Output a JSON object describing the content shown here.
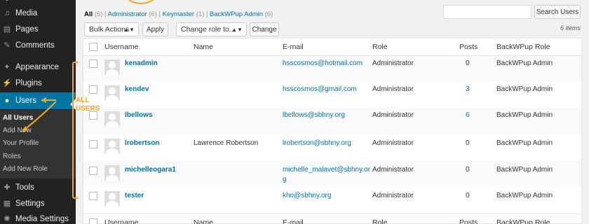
{
  "sidebar": {
    "items": [
      {
        "label": "Media",
        "icon": "media-icon",
        "glyph": "♫"
      },
      {
        "label": "Pages",
        "icon": "pages-icon",
        "glyph": "▤"
      },
      {
        "label": "Comments",
        "icon": "comments-icon",
        "glyph": "✎"
      },
      {
        "label": "Appearance",
        "icon": "appearance-icon",
        "glyph": "✦"
      },
      {
        "label": "Plugins",
        "icon": "plugins-icon",
        "glyph": "⚡"
      },
      {
        "label": "Users",
        "icon": "users-icon",
        "glyph": "●"
      },
      {
        "label": "Tools",
        "icon": "tools-icon",
        "glyph": "✚"
      },
      {
        "label": "Settings",
        "icon": "settings-icon",
        "glyph": "▦"
      },
      {
        "label": "Media Settings",
        "icon": "gear-icon",
        "glyph": "✺"
      }
    ],
    "submenu": [
      "All Users",
      "Add New",
      "Your Profile",
      "Roles",
      "Add New Role"
    ]
  },
  "annotation": {
    "label_line1": "ALL",
    "label_line2": "USERS",
    "color": "#f5a623"
  },
  "filters": {
    "all": "All",
    "all_count": "(6)",
    "administrator": "Administrator",
    "administrator_count": "(6)",
    "keymaster": "Keymaster",
    "keymaster_count": "(1)",
    "backwpup_admin": "BackWPup Admin",
    "backwpup_admin_count": "(6)",
    "sep": "|"
  },
  "search": {
    "button_label": "Search Users",
    "placeholder": ""
  },
  "bulk": {
    "actions_label": "Bulk Actions",
    "apply_label": "Apply",
    "change_role_label": "Change role to...",
    "change_label": "Change"
  },
  "items_count": "6 items",
  "table": {
    "headers": {
      "username": "Username",
      "name": "Name",
      "email": "E-mail",
      "role": "Role",
      "posts": "Posts",
      "backwpup_role": "BackWPup Role"
    },
    "rows": [
      {
        "username": "kenadmin",
        "name": "",
        "email": "hsscosmos@hotmail.com",
        "role": "Administrator",
        "posts": "0",
        "backwpup_role": "BackWPup Admin"
      },
      {
        "username": "kendev",
        "name": "",
        "email": "hsscosmos@gmail.com",
        "role": "Administrator",
        "posts": "3",
        "backwpup_role": "BackWPup Admin"
      },
      {
        "username": "lbellows",
        "name": "",
        "email": "lbellows@sbhny.org",
        "role": "Administrator",
        "posts": "6",
        "backwpup_role": "BackWPup Admin"
      },
      {
        "username": "lrobertson",
        "name": "Lawrence Robertson",
        "email": "lrobertson@sbhny.org",
        "role": "Administrator",
        "posts": "0",
        "backwpup_role": "BackWPup Admin"
      },
      {
        "username": "michelleogara1",
        "name": "",
        "email_line1": "michelle_malavet@sbhny.or",
        "email_line2": "g",
        "role": "Administrator",
        "posts": "0",
        "backwpup_role": "BackWPup Admin"
      },
      {
        "username": "tester",
        "name": "",
        "email": "kho@sbhny.org",
        "role": "Administrator",
        "posts": "0",
        "backwpup_role": "BackWPup Admin"
      }
    ]
  },
  "colors": {
    "accent": "#0074a2",
    "sidebar_bg": "#222222",
    "annotation": "#f5a623"
  }
}
